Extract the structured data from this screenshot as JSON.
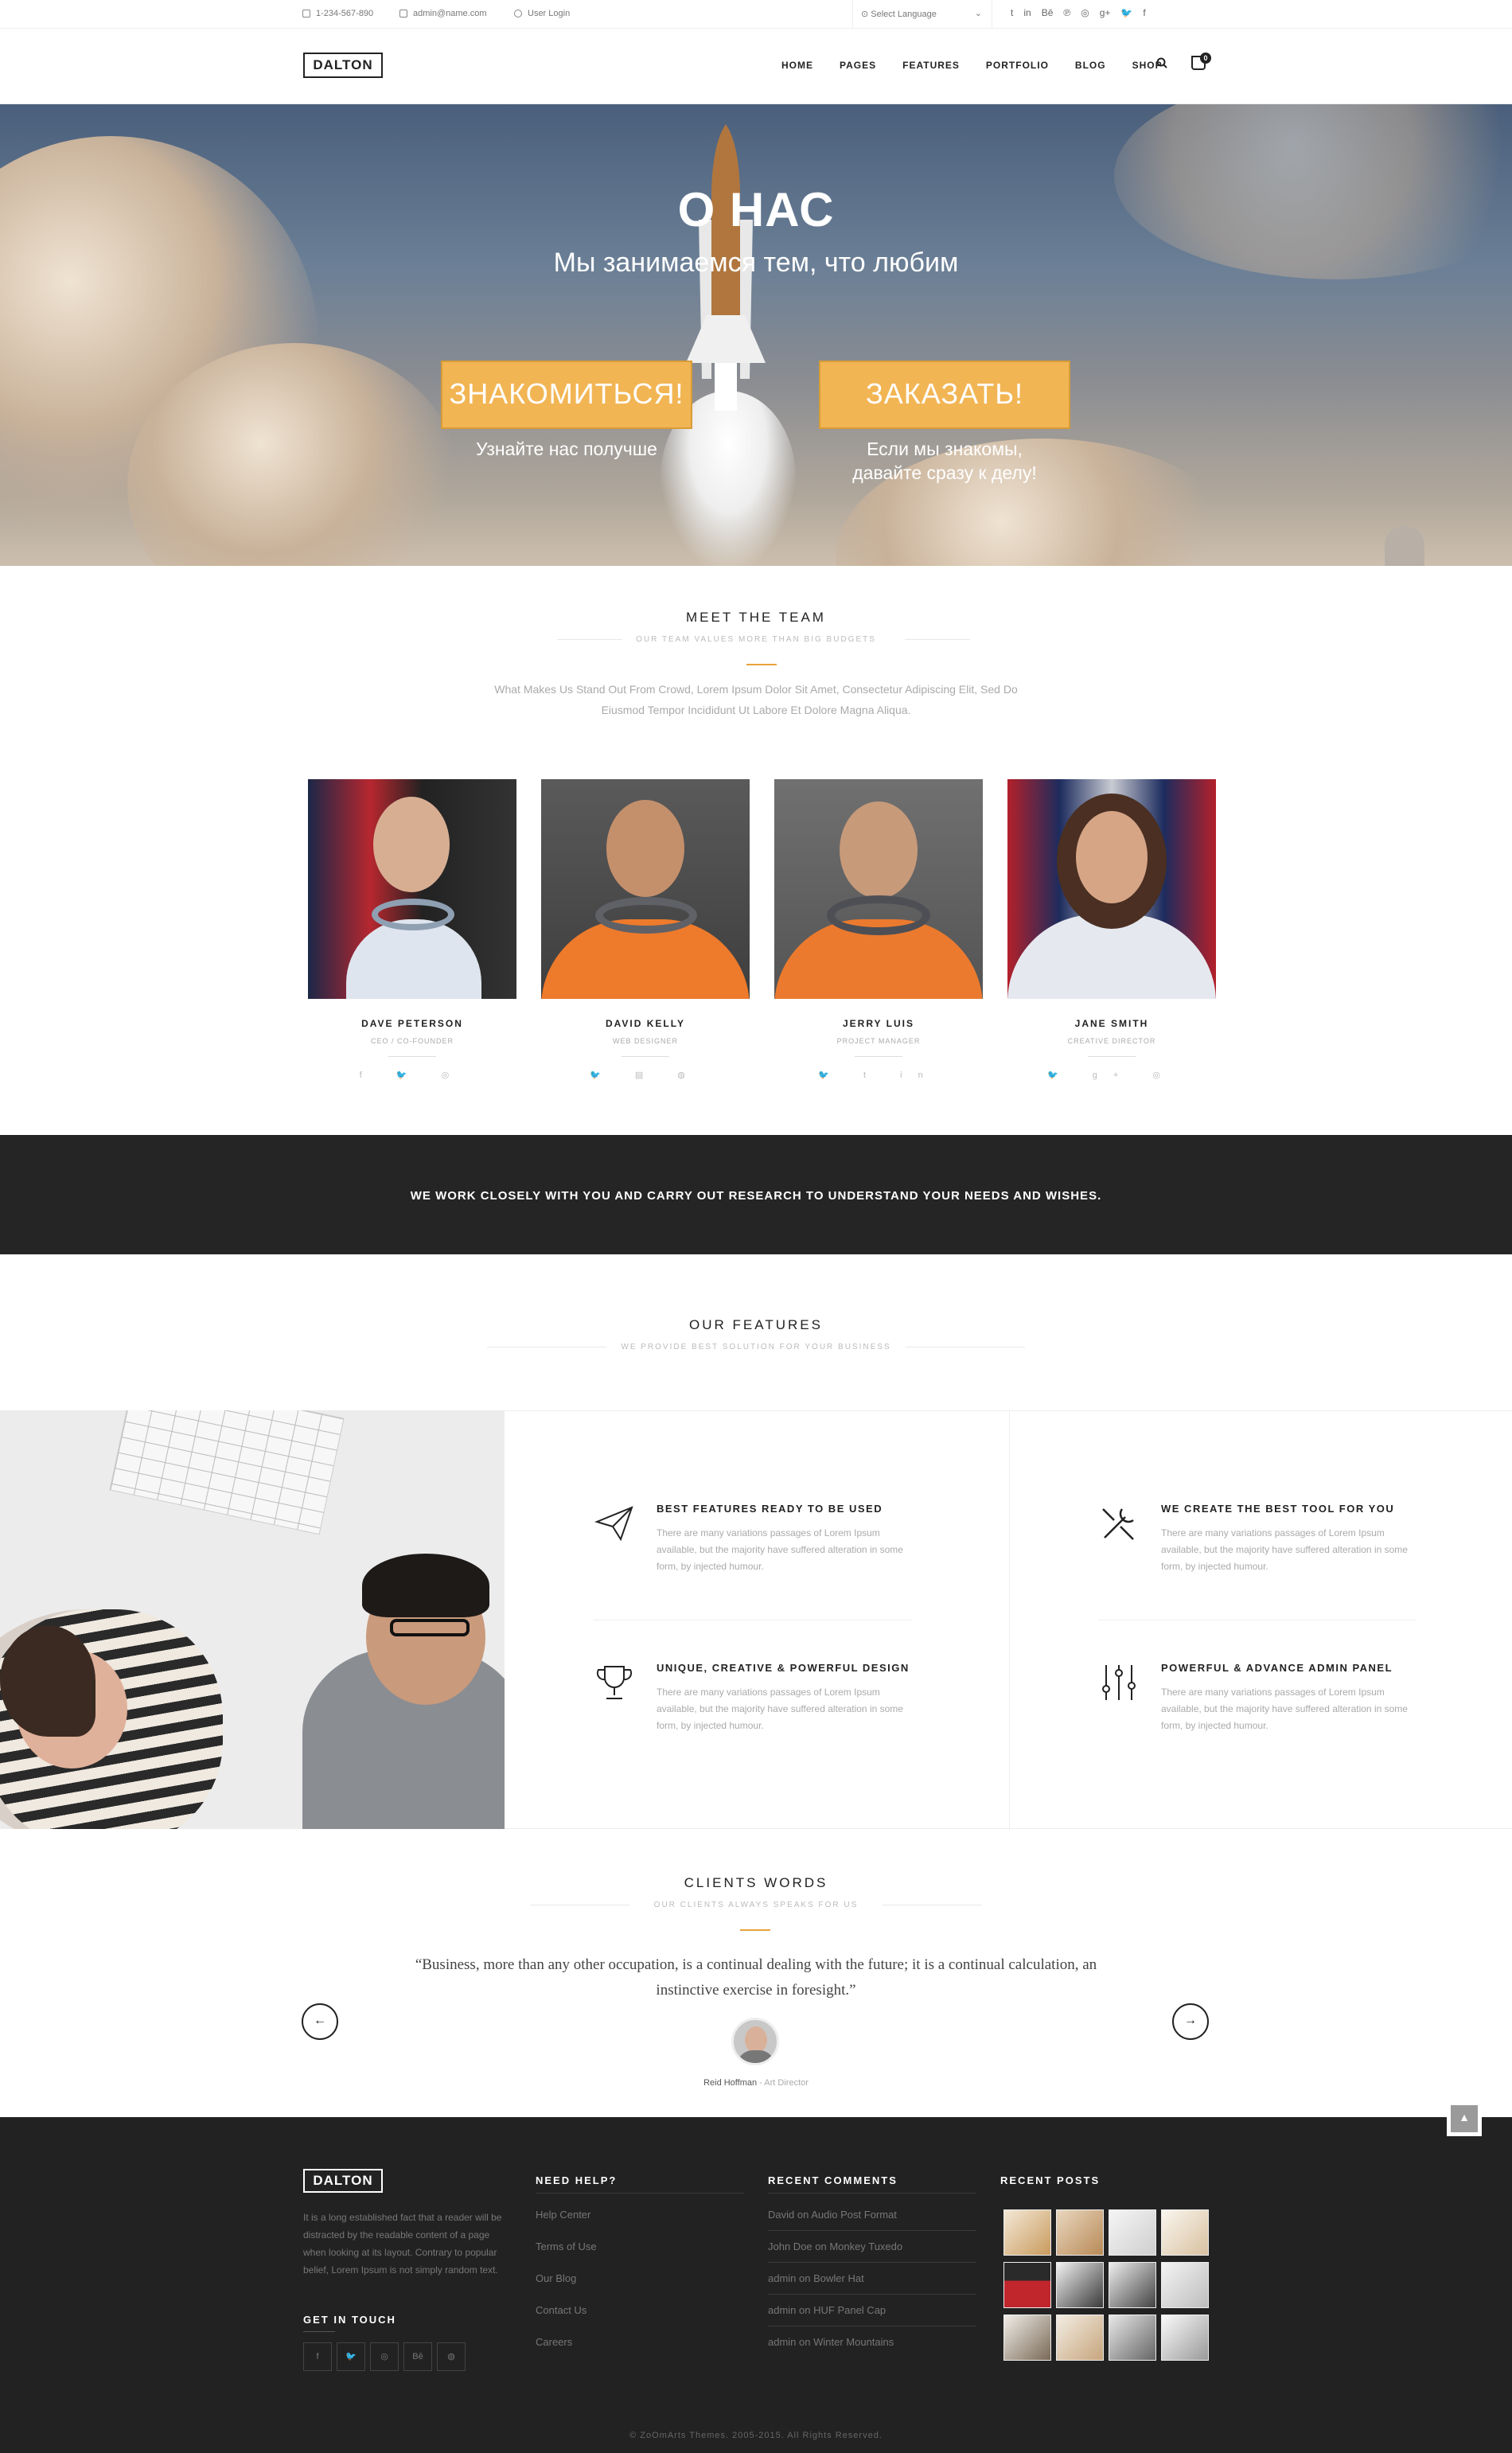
{
  "topbar": {
    "phone": "1-234-567-890",
    "email": "admin@name.com",
    "login": "User Login",
    "language": "Select Language",
    "social": [
      "t",
      "in",
      "Bē",
      "℗",
      "◎",
      "g+",
      "🐦",
      "f"
    ]
  },
  "header": {
    "logo": "DALTON",
    "nav": [
      "HOME",
      "PAGES",
      "FEATURES",
      "PORTFOLIO",
      "BLOG",
      "SHOP"
    ],
    "cart_count": "0"
  },
  "hero": {
    "title": "О НАС",
    "subtitle": "Мы занимаемся тем, что любим",
    "btn_left": "ЗНАКОМИТЬСЯ!",
    "caption_left": "Узнайте нас получше",
    "btn_right": "ЗАКАЗАТЬ!",
    "caption_right_1": "Если мы знакомы,",
    "caption_right_2": "давайте сразу к делу!"
  },
  "team": {
    "title": "MEET THE TEAM",
    "subtitle": "OUR TEAM VALUES MORE THAN BIG BUDGETS",
    "lead_1": "What Makes Us Stand Out From Crowd, Lorem Ipsum Dolor Sit Amet, Consectetur Adipiscing Elit, Sed Do",
    "lead_2": "Eiusmod Tempor Incididunt Ut Labore Et Dolore Magna Aliqua.",
    "members": [
      {
        "name": "DAVE PETERSON",
        "role": "CEO / CO-FOUNDER",
        "social": "f  🐦  ◎"
      },
      {
        "name": "DAVID KELLY",
        "role": "WEB DESIGNER",
        "social": "🐦  ▤  ◍"
      },
      {
        "name": "JERRY LUIS",
        "role": "PROJECT MANAGER",
        "social": "🐦  t  in"
      },
      {
        "name": "JANE SMITH",
        "role": "CREATIVE DIRECTOR",
        "social": "🐦  g+  ◎"
      }
    ]
  },
  "band": {
    "text": "WE WORK CLOSELY WITH YOU AND CARRY OUT RESEARCH TO UNDERSTAND YOUR NEEDS AND WISHES."
  },
  "features": {
    "title": "OUR FEATURES",
    "subtitle": "WE PROVIDE BEST SOLUTION FOR YOUR BUSINESS",
    "items": [
      {
        "title": "BEST FEATURES READY TO BE USED",
        "text": "There are many variations passages of Lorem Ipsum available, but the majority have suffered alteration in some form, by injected humour."
      },
      {
        "title": "WE CREATE THE BEST TOOL FOR YOU",
        "text": "There are many variations passages of Lorem Ipsum available, but the majority have suffered alteration in some form, by injected humour."
      },
      {
        "title": "UNIQUE, CREATIVE & POWERFUL DESIGN",
        "text": "There are many variations passages of Lorem Ipsum available, but the majority have suffered alteration in some form, by injected humour."
      },
      {
        "title": "POWERFUL & ADVANCE ADMIN PANEL",
        "text": "There are many variations passages of Lorem Ipsum available, but the majority have suffered alteration in some form, by injected humour."
      }
    ]
  },
  "clients": {
    "title": "CLIENTS WORDS",
    "subtitle": "OUR CLIENTS ALWAYS SPEAKS FOR US",
    "quote_1": "“Business, more than any other occupation, is a continual dealing with the future; it is a continual calculation, an",
    "quote_2": "instinctive exercise in foresight.”",
    "author": "Reid Hoffman",
    "author_role": " - Art Director"
  },
  "footer": {
    "logo": "DALTON",
    "about": "It is a long established fact that a reader will be distracted by the readable content of a page when looking at its layout. Contrary to popular belief, Lorem Ipsum is not simply random text.",
    "get_in_touch": "GET IN TOUCH",
    "social": [
      "f",
      "🐦",
      "◎",
      "Bē",
      "◍"
    ],
    "help_title": "NEED HELP?",
    "help_links": [
      "Help Center",
      "Terms of Use",
      "Our Blog",
      "Contact Us",
      "Careers"
    ],
    "comments_title": "RECENT COMMENTS",
    "comments": [
      {
        "who": "David",
        "on": " on ",
        "post": "Audio Post Format"
      },
      {
        "who": "John Doe",
        "on": " on ",
        "post": "Monkey Tuxedo"
      },
      {
        "who": "admin",
        "on": " on ",
        "post": "Bowler Hat"
      },
      {
        "who": "admin",
        "on": " on ",
        "post": "HUF Panel Cap"
      },
      {
        "who": "admin",
        "on": " on ",
        "post": "Winter Mountains"
      }
    ],
    "posts_title": "RECENT POSTS",
    "copyright": "© ZoOmArts Themes. 2005-2015. All Rights Reserved."
  },
  "colors": {
    "accent": "#f2b554",
    "dark": "#252525",
    "footer": "#222222"
  }
}
